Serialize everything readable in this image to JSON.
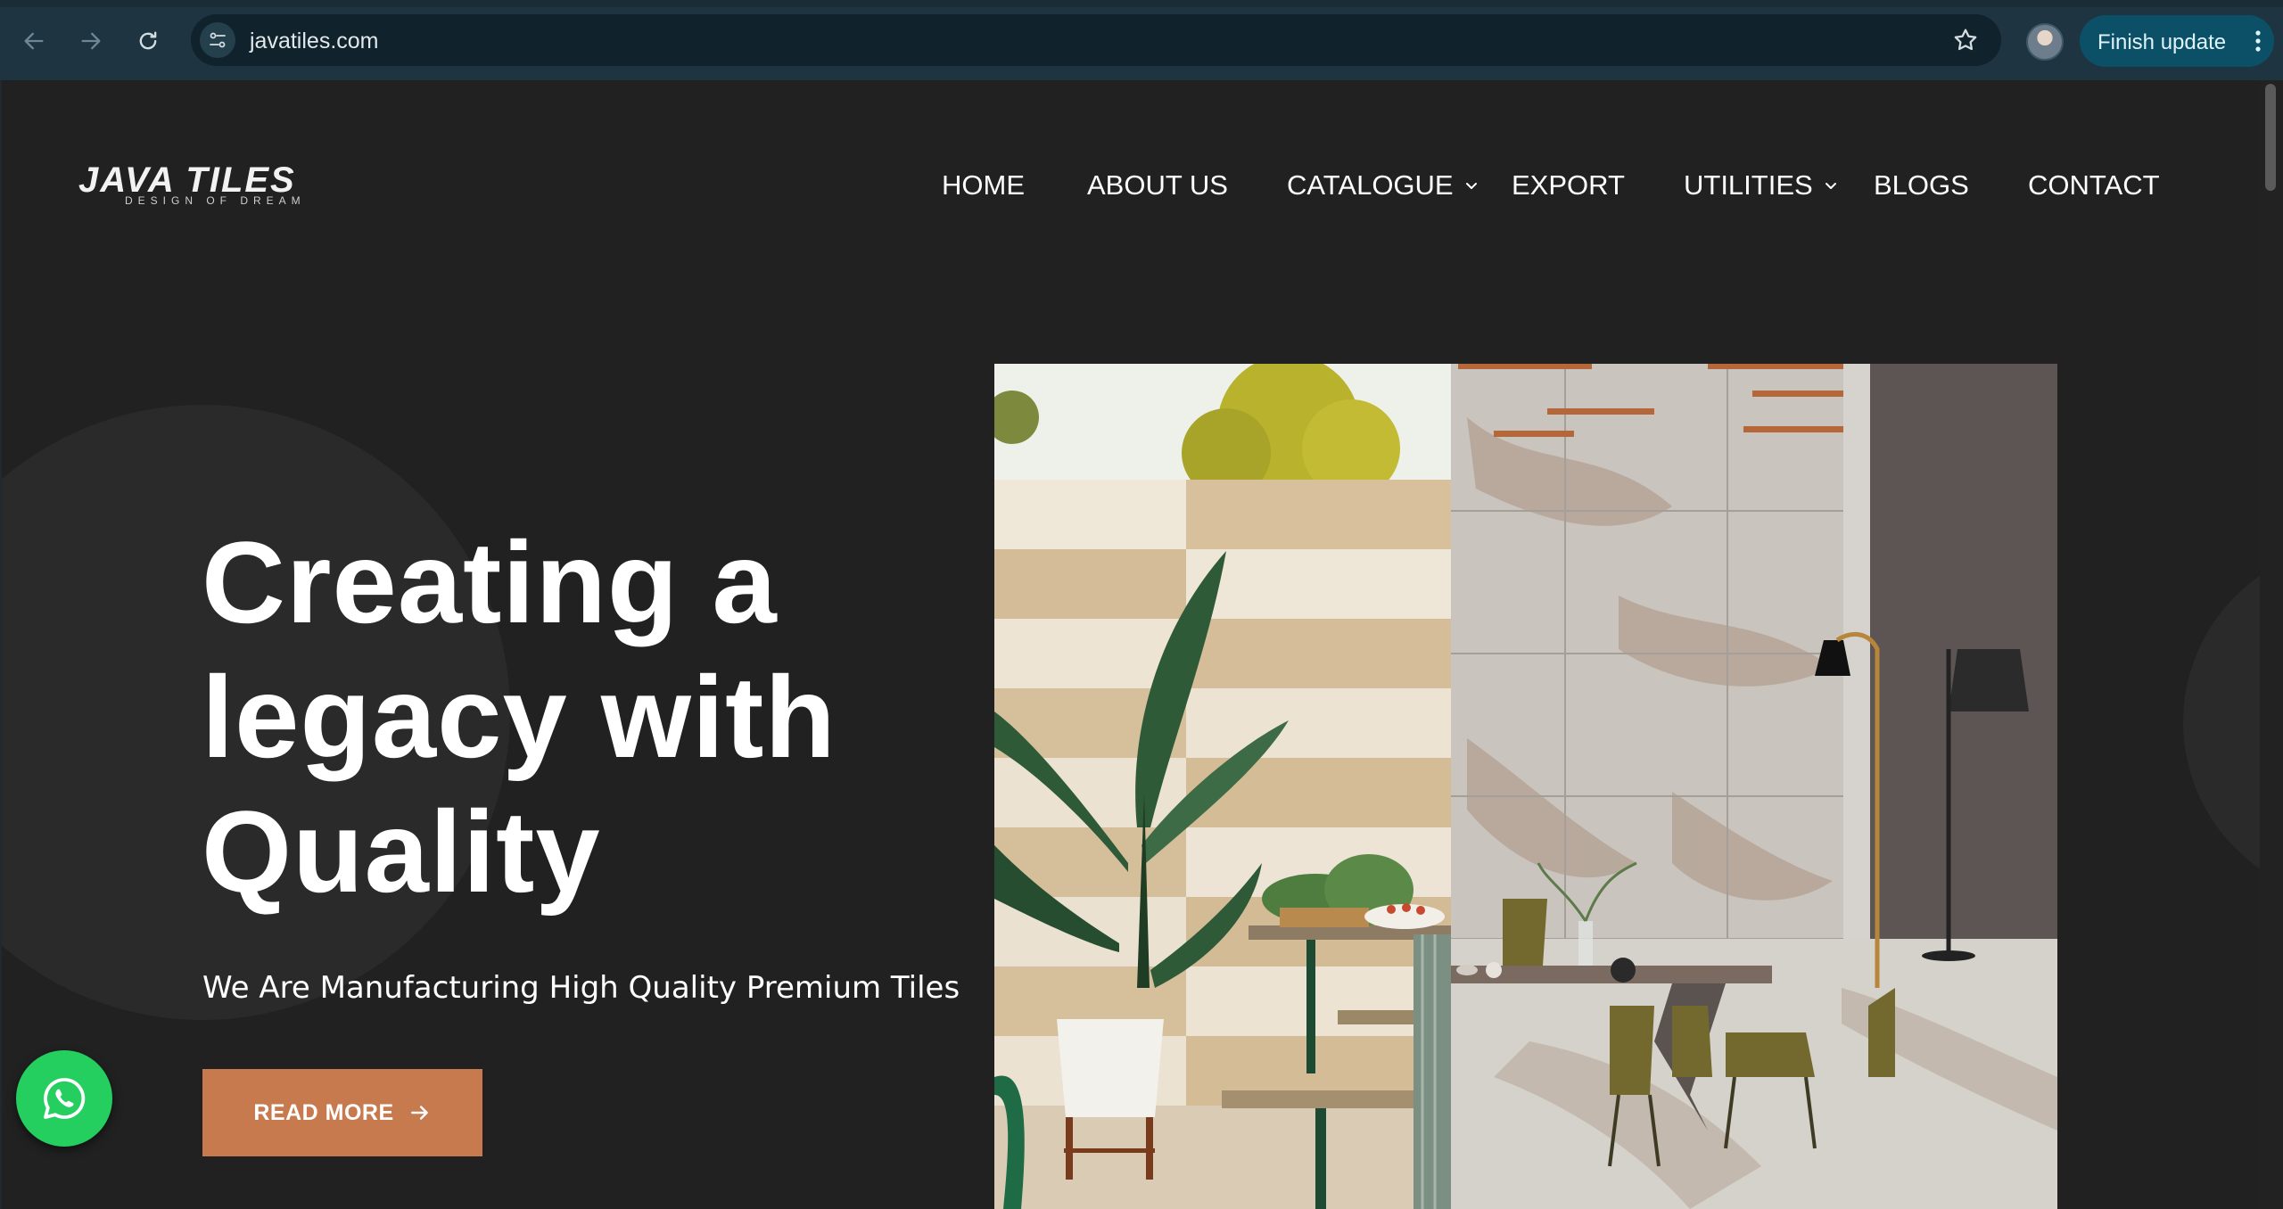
{
  "browser": {
    "url": "javatiles.com",
    "finish_update_label": "Finish update"
  },
  "site": {
    "logo_text": "JAVA TILES",
    "logo_tagline": "DESIGN OF DREAM",
    "menu": [
      "HOME",
      "ABOUT US",
      "CATALOGUE",
      "EXPORT",
      "UTILITIES",
      "BLOGS",
      "CONTACT"
    ],
    "hero": {
      "title": "Creating a\nlegacy with\nQuality",
      "subtitle": "We Are Manufacturing High Quality Premium Tiles",
      "cta_label": "READ MORE"
    }
  },
  "colors": {
    "accent": "#c87a4f",
    "page_bg": "#212121",
    "whatsapp": "#25cf5f",
    "chrome_bg": "#1e3440"
  },
  "icons": [
    "back-arrow-icon",
    "forward-arrow-icon",
    "reload-icon",
    "site-info-icon",
    "bookmark-star-icon",
    "profile-avatar",
    "more-vert-icon",
    "chevron-down-icon",
    "arrow-right-icon",
    "whatsapp-icon"
  ]
}
